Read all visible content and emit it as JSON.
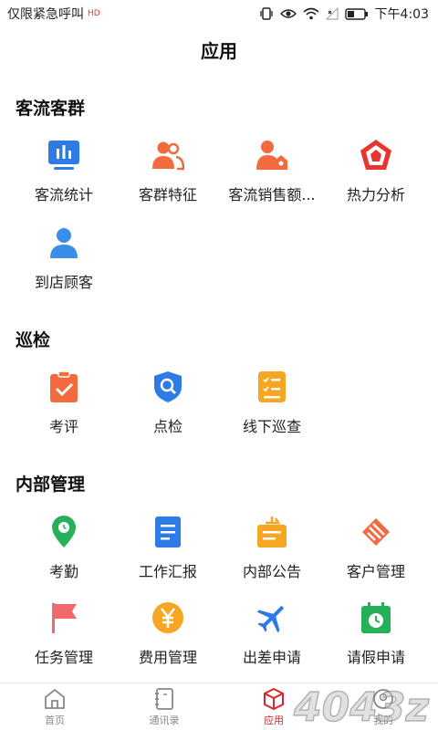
{
  "status_bar": {
    "carrier_text": "仅限紧急呼叫",
    "hd_badge": "HD",
    "time": "下午4:03"
  },
  "header": {
    "title": "应用"
  },
  "sections": [
    {
      "title": "客流客群",
      "items": [
        {
          "label": "客流统计",
          "icon": "bar-chart-icon",
          "color": "#2f7be5"
        },
        {
          "label": "客群特征",
          "icon": "users-icon",
          "color": "#f26a3d"
        },
        {
          "label": "客流销售额...",
          "icon": "user-sales-icon",
          "color": "#f26a3d"
        },
        {
          "label": "热力分析",
          "icon": "heat-pentagon-icon",
          "color": "#e8352f"
        },
        {
          "label": "到店顾客",
          "icon": "customer-icon",
          "color": "#3b8ee8"
        }
      ]
    },
    {
      "title": "巡检",
      "items": [
        {
          "label": "考评",
          "icon": "clipboard-check-icon",
          "color": "#f26a3d"
        },
        {
          "label": "点检",
          "icon": "shield-search-icon",
          "color": "#2f7be5"
        },
        {
          "label": "线下巡查",
          "icon": "checklist-icon",
          "color": "#f5a623"
        }
      ]
    },
    {
      "title": "内部管理",
      "items": [
        {
          "label": "考勤",
          "icon": "location-pin-icon",
          "color": "#27b05a"
        },
        {
          "label": "工作汇报",
          "icon": "document-icon",
          "color": "#2f7be5"
        },
        {
          "label": "内部公告",
          "icon": "announcement-icon",
          "color": "#f5a623"
        },
        {
          "label": "客户管理",
          "icon": "customer-manage-icon",
          "color": "#f26a3d"
        },
        {
          "label": "任务管理",
          "icon": "flag-icon",
          "color": "#f0696b"
        },
        {
          "label": "费用管理",
          "icon": "yen-coin-icon",
          "color": "#f5a623"
        },
        {
          "label": "出差申请",
          "icon": "airplane-icon",
          "color": "#2f7be5"
        },
        {
          "label": "请假申请",
          "icon": "calendar-clock-icon",
          "color": "#27b05a"
        }
      ]
    }
  ],
  "tab_bar": [
    {
      "label": "首页",
      "icon": "home-icon",
      "active": false
    },
    {
      "label": "通讯录",
      "icon": "contacts-book-icon",
      "active": false
    },
    {
      "label": "应用",
      "icon": "cube-icon",
      "active": true
    },
    {
      "label": "我的",
      "icon": "profile-icon",
      "active": false
    }
  ],
  "watermark": {
    "text": "4043z"
  },
  "colors": {
    "accent": "#d9262c"
  }
}
